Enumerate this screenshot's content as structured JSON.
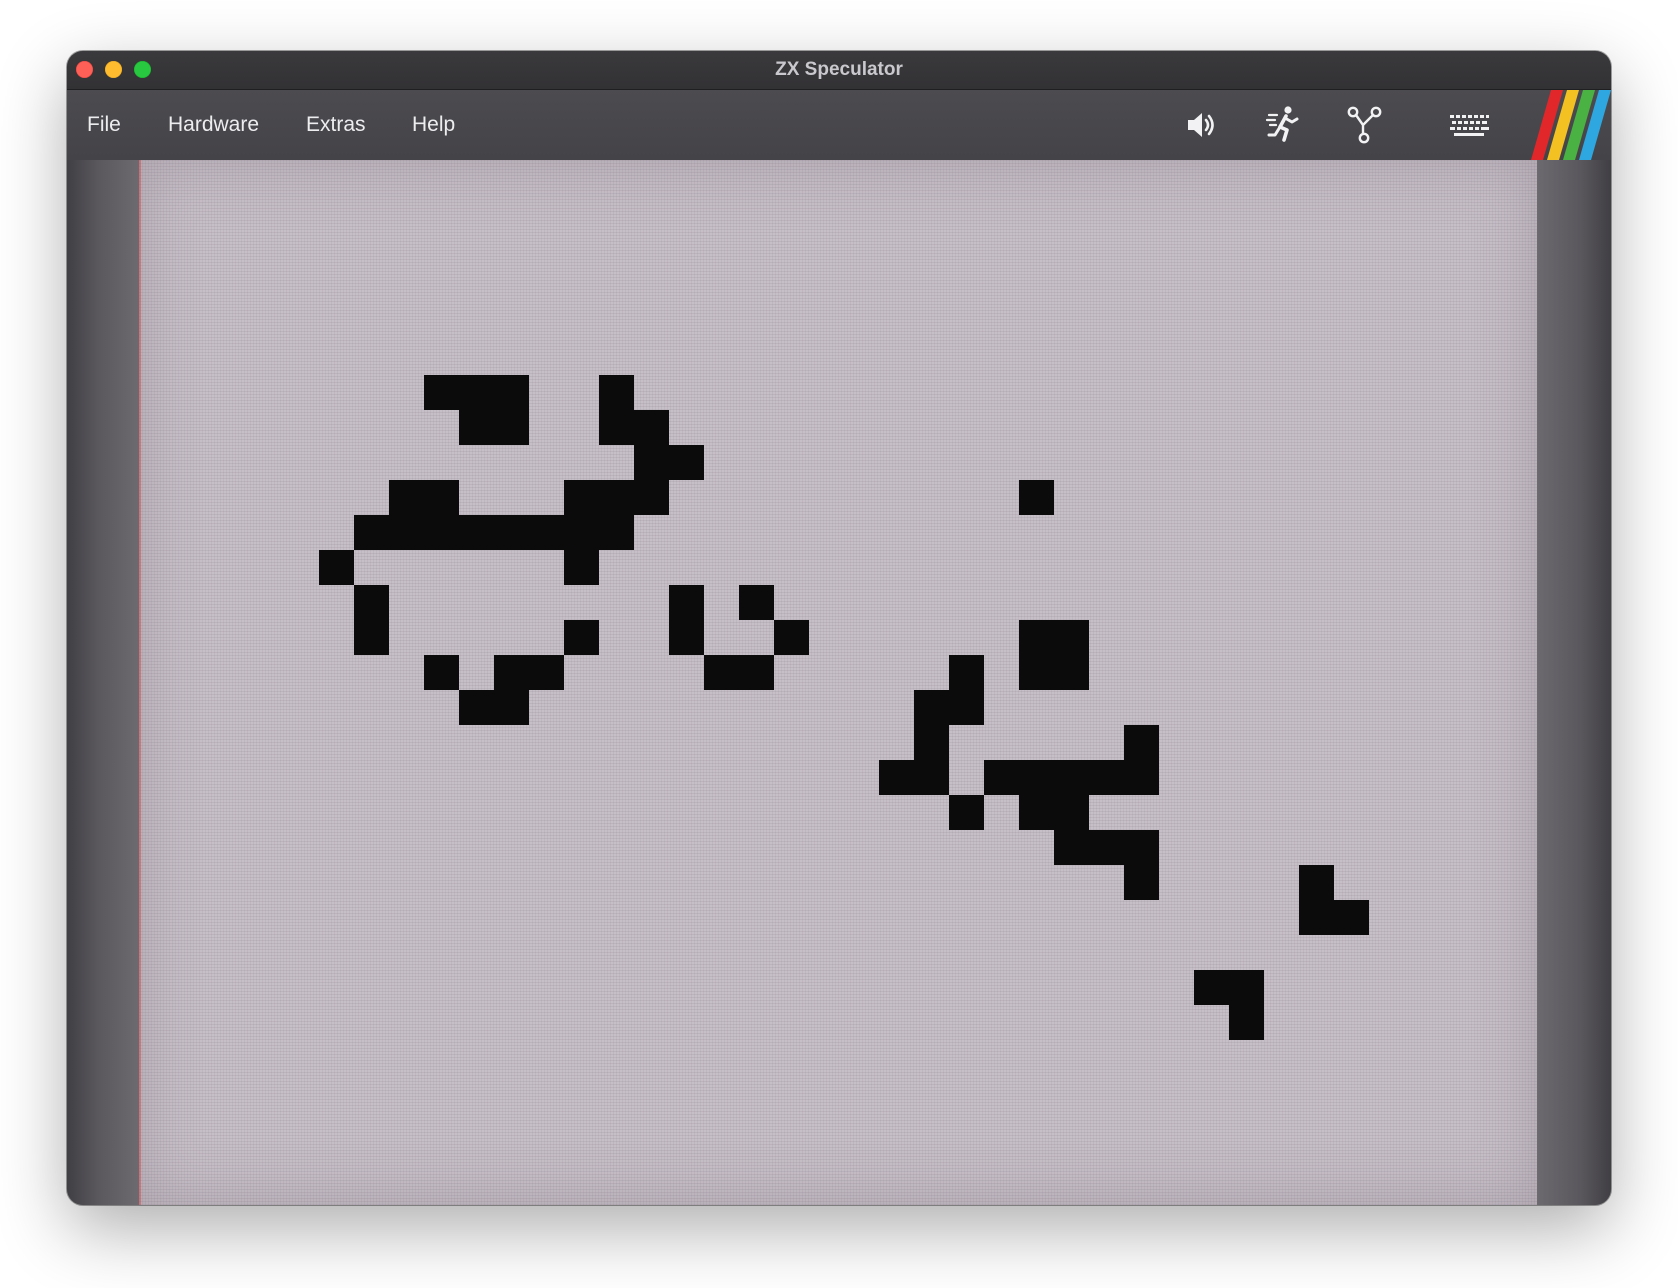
{
  "window": {
    "title": "ZX Speculator"
  },
  "menu": {
    "file": "File",
    "hardware": "Hardware",
    "extras": "Extras",
    "help": "Help"
  },
  "toolbar_icons": [
    "speaker-icon",
    "running-man-icon",
    "branch-icon",
    "keyboard-icon"
  ],
  "colors": {
    "screen_paper": "#c7bfc7",
    "ink": "#0b0b0b",
    "rainbow": [
      "#e2272b",
      "#f4c123",
      "#4ab242",
      "#2ea7e0"
    ]
  },
  "display": {
    "grid_unit": 35,
    "cells": [
      [
        8,
        6
      ],
      [
        9,
        6
      ],
      [
        10,
        6
      ],
      [
        13,
        6
      ],
      [
        9,
        7
      ],
      [
        10,
        7
      ],
      [
        13,
        7
      ],
      [
        14,
        7
      ],
      [
        14,
        8
      ],
      [
        15,
        8
      ],
      [
        7,
        9
      ],
      [
        8,
        9
      ],
      [
        12,
        9
      ],
      [
        13,
        9
      ],
      [
        14,
        9
      ],
      [
        25,
        9
      ],
      [
        6,
        10
      ],
      [
        7,
        10
      ],
      [
        8,
        10
      ],
      [
        9,
        10
      ],
      [
        10,
        10
      ],
      [
        11,
        10
      ],
      [
        12,
        10
      ],
      [
        13,
        10
      ],
      [
        5,
        11
      ],
      [
        12,
        11
      ],
      [
        6,
        12
      ],
      [
        15,
        12
      ],
      [
        17,
        12
      ],
      [
        6,
        13
      ],
      [
        12,
        13
      ],
      [
        15,
        13
      ],
      [
        18,
        13
      ],
      [
        25,
        13
      ],
      [
        26,
        13
      ],
      [
        8,
        14
      ],
      [
        10,
        14
      ],
      [
        11,
        14
      ],
      [
        16,
        14
      ],
      [
        17,
        14
      ],
      [
        23,
        14
      ],
      [
        25,
        14
      ],
      [
        26,
        14
      ],
      [
        9,
        15
      ],
      [
        10,
        15
      ],
      [
        22,
        15
      ],
      [
        23,
        15
      ],
      [
        22,
        16
      ],
      [
        28,
        16
      ],
      [
        21,
        17
      ],
      [
        22,
        17
      ],
      [
        24,
        17
      ],
      [
        25,
        17
      ],
      [
        26,
        17
      ],
      [
        27,
        17
      ],
      [
        28,
        17
      ],
      [
        23,
        18
      ],
      [
        25,
        18
      ],
      [
        26,
        18
      ],
      [
        26,
        19
      ],
      [
        27,
        19
      ],
      [
        28,
        19
      ],
      [
        28,
        20
      ],
      [
        33,
        20
      ],
      [
        33,
        21
      ],
      [
        34,
        21
      ],
      [
        30,
        23
      ],
      [
        31,
        23
      ],
      [
        31,
        24
      ]
    ]
  }
}
